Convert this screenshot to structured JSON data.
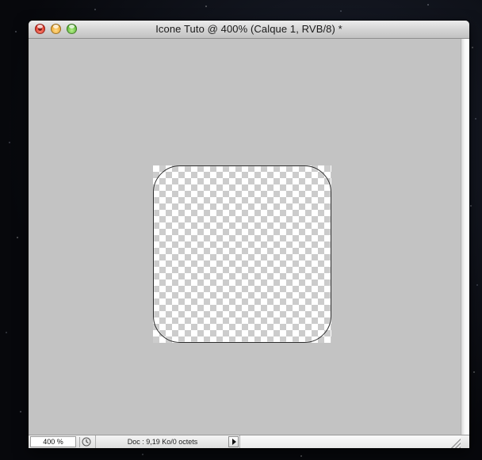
{
  "window": {
    "title": "Icone Tuto @ 400% (Calque 1, RVB/8) *",
    "controls": {
      "close": "close-button",
      "minimize": "minimize-button",
      "zoom": "zoom-button"
    }
  },
  "canvas": {
    "background_color": "#c3c3c3",
    "layer": "Calque 1",
    "content": "rounded-rectangle-path-on-transparent-layer"
  },
  "statusbar": {
    "zoom_value": "400 %",
    "doc_info": "Doc : 9,19 Ko/0 octets",
    "info_icon": "document-status-icon",
    "menu_icon": "play-arrow-icon"
  },
  "colors": {
    "titlebar": "#d3d3d3",
    "pasteboard": "#c3c3c3",
    "checker_dark": "#cccccc",
    "checker_light": "#ffffff",
    "path_stroke": "#2c2c2c"
  }
}
